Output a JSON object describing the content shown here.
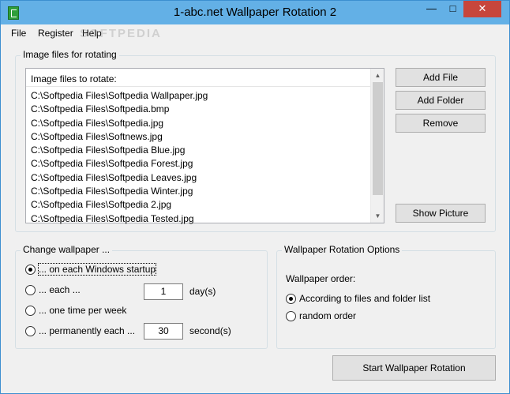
{
  "window": {
    "title": "1-abc.net Wallpaper Rotation 2",
    "controls": {
      "minimize": "—",
      "maximize": "□",
      "close": "✕"
    }
  },
  "menu": {
    "file": "File",
    "register": "Register",
    "help": "Help"
  },
  "watermark": "SOFTPEDIA",
  "files_group": {
    "label": "Image files for rotating",
    "list_header": "Image files to rotate:",
    "items": [
      "C:\\Softpedia Files\\Softpedia Wallpaper.jpg",
      "C:\\Softpedia Files\\Softpedia.bmp",
      "C:\\Softpedia Files\\Softpedia.jpg",
      "C:\\Softpedia Files\\Softnews.jpg",
      "C:\\Softpedia Files\\Softpedia Blue.jpg",
      "C:\\Softpedia Files\\Softpedia Forest.jpg",
      "C:\\Softpedia Files\\Softpedia Leaves.jpg",
      "C:\\Softpedia Files\\Softpedia Winter.jpg",
      "C:\\Softpedia Files\\Softpedia 2.jpg",
      "C:\\Softpedia Files\\Softpedia Tested.jpg"
    ],
    "buttons": {
      "add_file": "Add File",
      "add_folder": "Add Folder",
      "remove": "Remove",
      "show_picture": "Show Picture"
    }
  },
  "change_group": {
    "label": "Change wallpaper ...",
    "options": {
      "startup": "... on each Windows startup",
      "each": "... each ...",
      "weekly": "... one time per week",
      "permanent": "... permanently each ..."
    },
    "days_value": "1",
    "days_unit": "day(s)",
    "seconds_value": "30",
    "seconds_unit": "second(s)",
    "selected": "startup"
  },
  "options_group": {
    "label": "Wallpaper Rotation Options",
    "order_label": "Wallpaper order:",
    "order_options": {
      "list": "According to files and folder list",
      "random": "random order"
    },
    "selected": "list"
  },
  "start_button": "Start Wallpaper Rotation",
  "colors": {
    "titlebar": "#63b0e6",
    "close_button": "#c7463c",
    "window_bg": "#f0f0f0"
  }
}
